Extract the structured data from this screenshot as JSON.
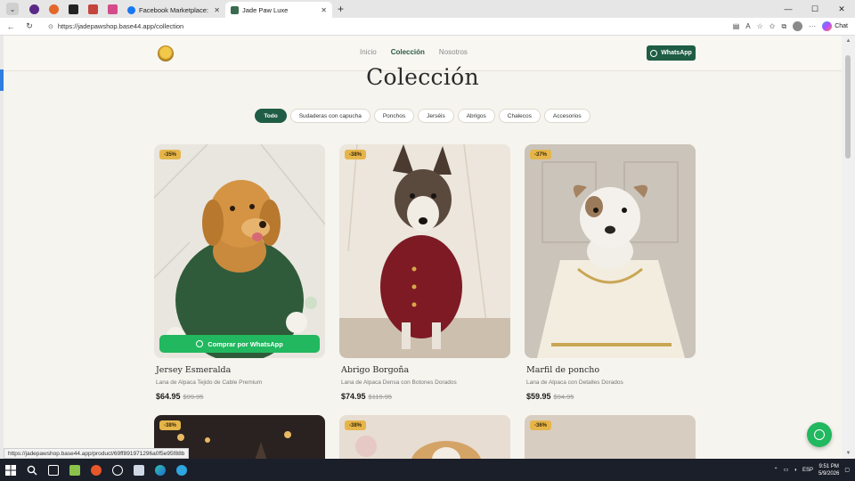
{
  "browser": {
    "tabs": [
      {
        "title": "Facebook Marketplace: Compra y",
        "close": "✕",
        "color": "#1877f2"
      },
      {
        "title": "Jade Paw Luxe",
        "close": "✕",
        "color": "#3a6b4e"
      }
    ],
    "new_tab": "+",
    "window_controls": [
      "—",
      "☐",
      "✕"
    ],
    "url": "https://jadepawshop.base44.app/collection",
    "chat_label": "Chat"
  },
  "site": {
    "nav": [
      "Inicio",
      "Colección",
      "Nosotros"
    ],
    "whatsapp_label": "WhatsApp",
    "heading": "Colección",
    "filters": [
      "Todo",
      "Sudaderas con capucha",
      "Ponchos",
      "Jerséis",
      "Abrigos",
      "Chalecos",
      "Accesorios"
    ],
    "buy_label": "Comprar por WhatsApp",
    "products": [
      {
        "badge": "-35%",
        "name": "Jersey Esmeralda",
        "desc": "Lana de Alpaca Tejido de Cable Premium",
        "price": "$64.95",
        "old_price": "$99.95"
      },
      {
        "badge": "-38%",
        "name": "Abrigo Borgoña",
        "desc": "Lana de Alpaca Densa con Botones Dorados",
        "price": "$74.95",
        "old_price": "$119.95"
      },
      {
        "badge": "-37%",
        "name": "Marfil de poncho",
        "desc": "Lana de Alpaca con Detalles Dorados",
        "price": "$59.95",
        "old_price": "$94.95"
      }
    ],
    "row2_badges": [
      "-38%",
      "-38%",
      "-36%"
    ]
  },
  "status_url": "https://jadepawshop.base44.app/product/69ff891971296a0f5e95f88b",
  "taskbar": {
    "lang": "ESP",
    "time": "9:51 PM",
    "date": "5/9/2026"
  },
  "colors": {
    "brand_green": "#1f5d45",
    "whatsapp_green": "#21b85f",
    "badge_gold": "#e6b54a",
    "page_bg": "#f6f4ee"
  }
}
